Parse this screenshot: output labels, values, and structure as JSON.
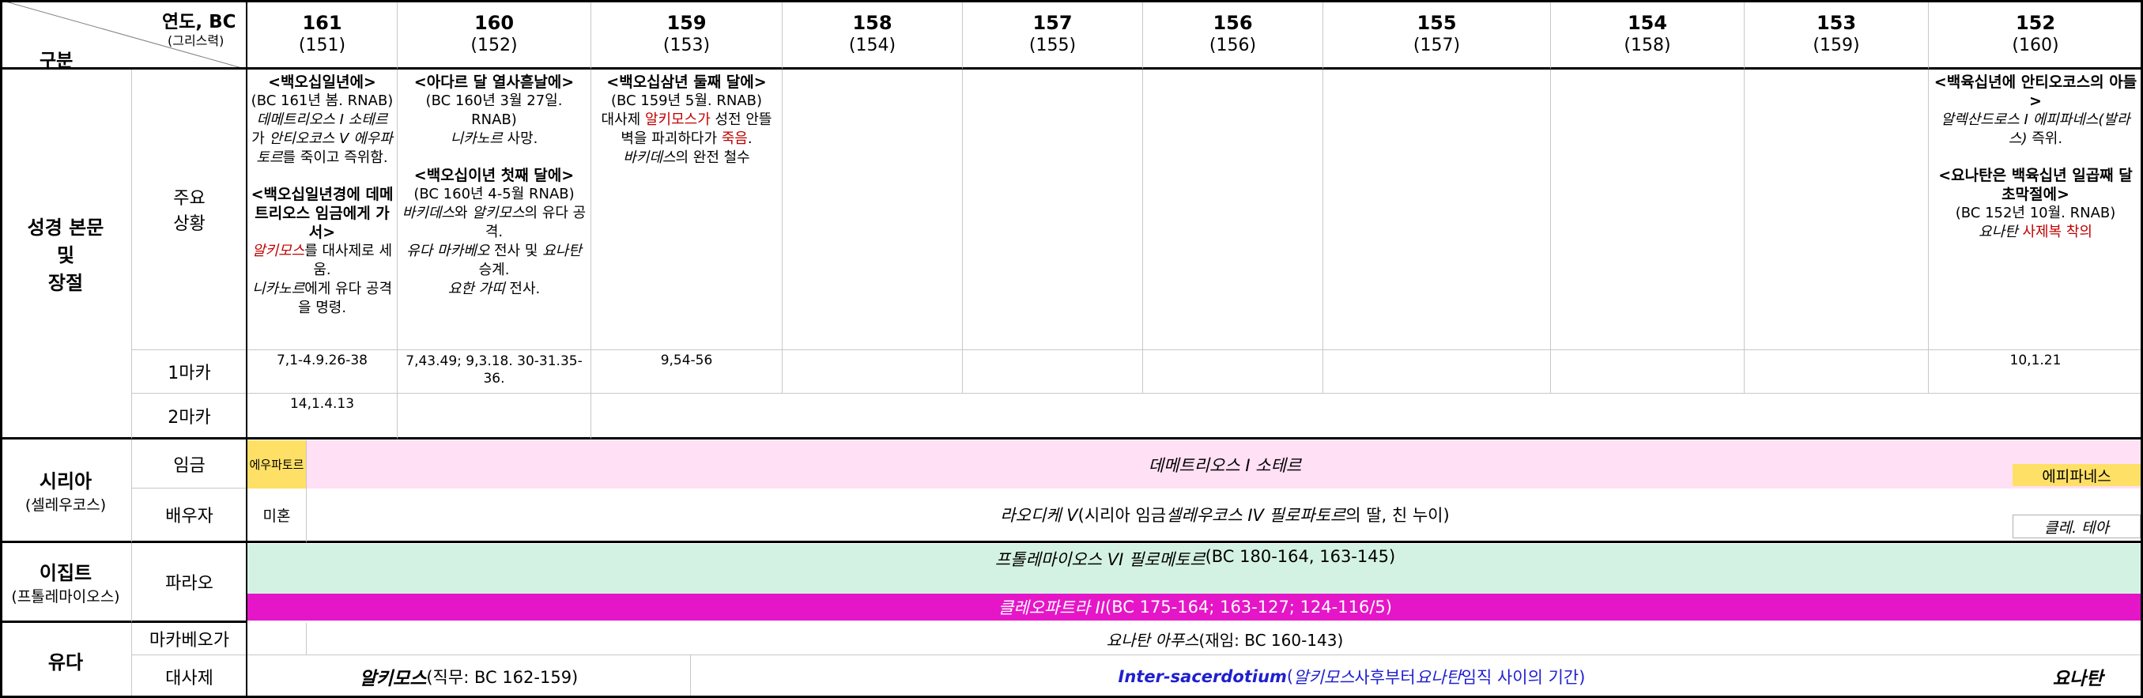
{
  "header": {
    "gubun": "구분",
    "year_label": "연도, BC",
    "greek_label": "(그리스력)",
    "years": [
      {
        "bc": "161",
        "greek": "(151)"
      },
      {
        "bc": "160",
        "greek": "(152)"
      },
      {
        "bc": "159",
        "greek": "(153)"
      },
      {
        "bc": "158",
        "greek": "(154)"
      },
      {
        "bc": "157",
        "greek": "(155)"
      },
      {
        "bc": "156",
        "greek": "(156)"
      },
      {
        "bc": "155",
        "greek": "(157)"
      },
      {
        "bc": "154",
        "greek": "(158)"
      },
      {
        "bc": "153",
        "greek": "(159)"
      },
      {
        "bc": "152",
        "greek": "(160)"
      }
    ]
  },
  "bible": {
    "group_label_1": "성경 본문",
    "group_label_2": "및",
    "group_label_3": "장절",
    "main_label_1": "주요",
    "main_label_2": "상황",
    "m1_label": "1마카",
    "m2_label": "2마카",
    "y161": {
      "h1": "<백오십일년에>",
      "l1": "(BC 161년 봄. RNAB)",
      "l2a": "데메트리오스 I 소테르",
      "l2b": "가 ",
      "l2c": "안티오코스 V 에우파토르",
      "l2d": "를 죽이고 즉위함.",
      "h2": "<백오십일년경에 데메트리오스 임금에게 가서>",
      "l3a": "알키모스",
      "l3b": "를 대사제로 세움.",
      "l4a": "니카노르",
      "l4b": "에게 유다 공격을 명령."
    },
    "y160": {
      "h1": "<아다르 달 열사흗날에>",
      "l1": "(BC 160년 3월 27일. RNAB)",
      "l2a": "니카노르",
      "l2b": " 사망.",
      "h2": "<백오십이년 첫째 달에>",
      "l3": "(BC 160년 4-5월 RNAB)",
      "l4a": "바키데스",
      "l4b": "와 ",
      "l4c": "알키모스",
      "l4d": "의 유다 공격.",
      "l5a": "유다 마카베오",
      "l5b": " 전사 및 ",
      "l5c": "요나탄",
      "l5d": " 승계.",
      "l6a": "요한 가띠",
      "l6b": " 전사."
    },
    "y159": {
      "h1": "<백오십삼년 둘째 달에>",
      "l1": "(BC 159년 5월. RNAB)",
      "l2a": "대사제 ",
      "l2b": "알키모스가",
      "l2c": " 성전 안뜰 벽을 파괴하다가 ",
      "l2d": "죽음",
      "l2e": ".",
      "l3a": "바키데스",
      "l3b": "의 완전 철수"
    },
    "y152": {
      "h1": "<백육십년에 안티오코스의 아들>",
      "l1a": "알렉산드로스  I 에피파네스",
      "l1b": "(발라스)",
      "l1c": " 즉위.",
      "h2": "<요나탄은 백육십년 일곱째 달 초막절에>",
      "l2": "(BC 152년 10월. RNAB)",
      "l3a": "요나탄",
      "l3b": " 사제복 착의"
    },
    "m1": {
      "y161": "7,1-4.9.26-38",
      "y160": "7,43.49; 9,3.18. 30-31.35-36.",
      "y159": "9,54-56",
      "y152": "10,1.21"
    },
    "m2": {
      "y161": "14,1.4.13"
    }
  },
  "syria": {
    "label": "시리아",
    "sub": "(셀레우코스)",
    "king_label": "임금",
    "spouse_label": "배우자",
    "king_a": "에우파토르",
    "king_b": "데메트리오스 I 소테르",
    "king_c": "에피파네스",
    "spouse_a": "미혼",
    "spouse_b1": "라오디케 V",
    "spouse_b2": " (시리아 임금 ",
    "spouse_b3": "셀레우코스 IV 필로파토르",
    "spouse_b4": "의 딸, 친 누이)",
    "spouse_c": "클레. 테아"
  },
  "egypt": {
    "label": "이집트",
    "sub": "(프톨레마이오스)",
    "pharaoh_label": "파라오",
    "ph1a": "프톨레마이오스 VI 필로메토르",
    "ph1b": " (BC 180-164, 163-145)",
    "ph2a": "클레오파트라 II",
    "ph2b": " (BC 175-164; 163-127; 124-116/5)"
  },
  "judah": {
    "label": "유다",
    "maccabee_label": "마카베오가",
    "priest_label": "대사제",
    "mac_a": "요나탄 아푸스",
    "mac_b": " (재임: BC 160-143)",
    "pr1a": "알키모스",
    "pr1b": " (직무: BC 162-159)",
    "pr2a": "Inter-sacerdotium",
    "pr2b": " (",
    "pr2c": "알키모스",
    "pr2d": " 사후부터 ",
    "pr2e": "요나탄",
    "pr2f": " 임직 사이의 기간)",
    "pr3": "요나탄"
  },
  "colors": {
    "yellow": "#ffe066",
    "pink": "#ffe0f5",
    "mint": "#d4f2e4",
    "magenta": "#e516c8",
    "red": "#c00000",
    "blue": "#1f1fcf"
  }
}
